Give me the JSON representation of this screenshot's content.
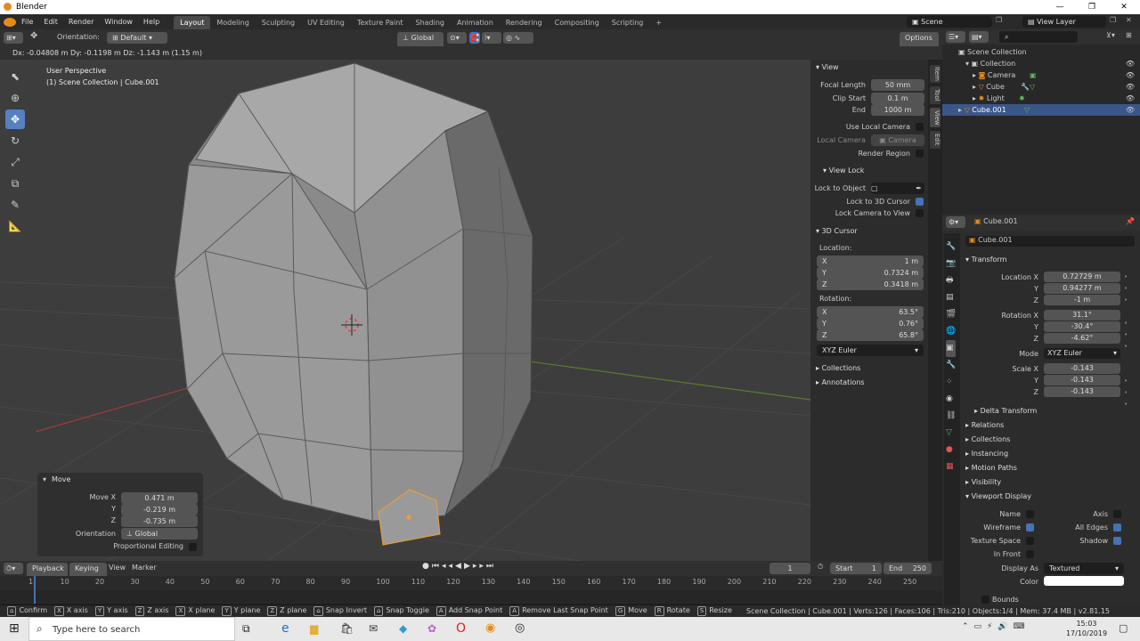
{
  "window": {
    "title": "Blender",
    "controls": [
      "—",
      "❐",
      "✕"
    ]
  },
  "menus": [
    "File",
    "Edit",
    "Render",
    "Window",
    "Help"
  ],
  "workspaces": [
    "Layout",
    "Modeling",
    "Sculpting",
    "UV Editing",
    "Texture Paint",
    "Shading",
    "Animation",
    "Rendering",
    "Compositing",
    "Scripting",
    "+"
  ],
  "scene": {
    "label": "Scene",
    "view_layer": "View Layer"
  },
  "header": {
    "orientation_label": "Orientation:",
    "orientation_value": "Default",
    "transform_space": "Global",
    "options": "Options"
  },
  "statusline": "Dx: -0.04808 m  Dy: -0.1198 m  Dz: -1.143 m (1.15 m)",
  "viewport": {
    "line1": "User Perspective",
    "line2": "(1) Scene Collection | Cube.001"
  },
  "npanel": {
    "view_title": "View",
    "focal_label": "Focal Length",
    "focal_value": "50 mm",
    "clip_start_label": "Clip Start",
    "clip_start_value": "0.1 m",
    "end_label": "End",
    "end_value": "1000 m",
    "use_local_camera": "Use Local Camera",
    "local_camera_label": "Local Camera",
    "local_camera_value": "Camera",
    "render_region": "Render Region",
    "view_lock_title": "View Lock",
    "lock_to_object": "Lock to Object",
    "lock_to_3d_cursor": "Lock to 3D Cursor",
    "lock_camera_to_view": "Lock Camera to View",
    "cursor_title": "3D Cursor",
    "location_label": "Location:",
    "loc": [
      {
        "axis": "X",
        "value": "1 m"
      },
      {
        "axis": "Y",
        "value": "0.7324 m"
      },
      {
        "axis": "Z",
        "value": "0.3418 m"
      }
    ],
    "rotation_label": "Rotation:",
    "rot": [
      {
        "axis": "X",
        "value": "63.5°"
      },
      {
        "axis": "Y",
        "value": "0.76°"
      },
      {
        "axis": "Z",
        "value": "65.8°"
      }
    ],
    "rot_mode": "XYZ Euler",
    "collections": "Collections",
    "annotations": "Annotations",
    "tabs": [
      "Item",
      "Tool",
      "View",
      "Edit"
    ]
  },
  "outliner": {
    "rows": [
      "Scene Collection",
      "Collection",
      "Camera",
      "Cube",
      "Light",
      "Cube.001"
    ]
  },
  "props": {
    "object_name_top": "Cube.001",
    "object_name": "Cube.001",
    "transform_title": "Transform",
    "location_x_label": "Location X",
    "location": [
      "0.72729 m",
      "0.94277 m",
      "-1 m"
    ],
    "rotation_x_label": "Rotation X",
    "rotation": [
      "31.1°",
      "-30.4°",
      "-4.62°"
    ],
    "mode_label": "Mode",
    "mode_value": "XYZ Euler",
    "scale_x_label": "Scale X",
    "scale": [
      "-0.143",
      "-0.143",
      "-0.143"
    ],
    "y_label": "Y",
    "z_label": "Z",
    "delta_transform": "Delta Transform",
    "relations": "Relations",
    "collections": "Collections",
    "instancing": "Instancing",
    "motion_paths": "Motion Paths",
    "visibility": "Visibility",
    "viewport_display": "Viewport Display",
    "name_label": "Name",
    "axis_label": "Axis",
    "wireframe_label": "Wireframe",
    "all_edges_label": "All Edges",
    "texture_space_label": "Texture Space",
    "shadow_label": "Shadow",
    "in_front_label": "In Front",
    "display_as_label": "Display As",
    "display_as_value": "Textured",
    "color_label": "Color",
    "bounds_label": "Bounds"
  },
  "move_panel": {
    "title": "Move",
    "move_x_label": "Move X",
    "move_x": "0.471 m",
    "y_label": "Y",
    "move_y": "-0.219 m",
    "z_label": "Z",
    "move_z": "-0.735 m",
    "orientation_label": "Orientation",
    "orientation_value": "Global",
    "proportional_label": "Proportional Editing"
  },
  "timeline": {
    "playback": "Playback",
    "keying": "Keying",
    "view": "View",
    "marker": "Marker",
    "current_frame": "1",
    "start_label": "Start",
    "start_value": "1",
    "end_label": "End",
    "end_value": "250",
    "ticks": [
      "1",
      "10",
      "20",
      "30",
      "40",
      "50",
      "60",
      "70",
      "80",
      "90",
      "100",
      "110",
      "120",
      "130",
      "140",
      "150",
      "160",
      "170",
      "180",
      "190",
      "200",
      "210",
      "220",
      "230",
      "240",
      "250"
    ],
    "current_frame_value": 1
  },
  "statusbar": {
    "items": [
      {
        "key": "",
        "label": "Confirm"
      },
      {
        "key": "X",
        "label": "X axis"
      },
      {
        "key": "Y",
        "label": "Y axis"
      },
      {
        "key": "Z",
        "label": "Z axis"
      },
      {
        "key": "X",
        "label": "X plane"
      },
      {
        "key": "Y",
        "label": "Y plane"
      },
      {
        "key": "Z",
        "label": "Z plane"
      },
      {
        "key": "",
        "label": "Snap Invert"
      },
      {
        "key": "",
        "label": "Snap Toggle"
      },
      {
        "key": "A",
        "label": "Add Snap Point"
      },
      {
        "key": "A",
        "label": "Remove Last Snap Point"
      },
      {
        "key": "G",
        "label": "Move"
      },
      {
        "key": "R",
        "label": "Rotate"
      },
      {
        "key": "S",
        "label": "Resize"
      }
    ],
    "right": "Scene Collection | Cube.001 | Verts:126 | Faces:106 | Tris:210 | Objects:1/4 | Mem: 37.4 MB | v2.81.15"
  },
  "taskbar": {
    "search_placeholder": "Type here to search",
    "time": "15:03",
    "date": "17/10/2019"
  },
  "colors": {
    "accent": "#4772b3",
    "orange": "#e68a1a",
    "viewport_bg": "#3d3d3d"
  }
}
